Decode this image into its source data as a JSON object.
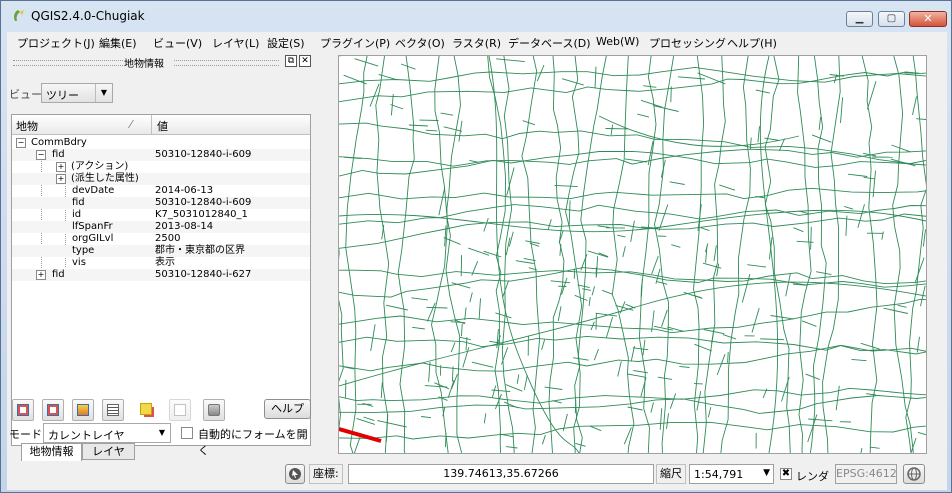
{
  "window": {
    "title": "QGIS2.4.0-Chugiak"
  },
  "menu": [
    "プロジェクト(J)",
    "編集(E)",
    "ビュー(V)",
    "レイヤ(L)",
    "設定(S)",
    "プラグイン(P)",
    "ベクタ(O)",
    "ラスタ(R)",
    "データベース(D)",
    "Web(W)",
    "プロセッシング",
    "ヘルプ(H)"
  ],
  "identify_panel": {
    "title": "地物情報",
    "view_label": "ビュー",
    "view_value": "ツリー",
    "columns": {
      "feature": "地物",
      "value": "値"
    },
    "layer": "CommBdry",
    "feature1": {
      "key": "fid",
      "value": "50310-12840-i-609"
    },
    "actions": "(アクション)",
    "derived": "(派生した属性)",
    "attributes": [
      {
        "key": "devDate",
        "value": "2014-06-13"
      },
      {
        "key": "fid",
        "value": "50310-12840-i-609"
      },
      {
        "key": "id",
        "value": "K7_5031012840_1"
      },
      {
        "key": "lfSpanFr",
        "value": "2013-08-14"
      },
      {
        "key": "orgGILvl",
        "value": "2500"
      },
      {
        "key": "type",
        "value": "郡市・東京都の区界"
      },
      {
        "key": "vis",
        "value": "表示"
      }
    ],
    "feature2": {
      "key": "fid",
      "value": "50310-12840-i-627"
    },
    "help_label": "ヘルプ",
    "mode_label": "モード",
    "mode_value": "カレントレイヤ",
    "auto_open_label": "自動的にフォームを開く",
    "tabs": [
      "地物情報",
      "レイヤ"
    ]
  },
  "statusbar": {
    "coord_label": "座標:",
    "coord_value": "139.74613,35.67266",
    "scale_label": "縮尺",
    "scale_value": "1:54,791",
    "render_label": "レンダ",
    "crs": "EPSG:4612"
  },
  "colors": {
    "roads": "#2e8b57",
    "highlight": "#e00000"
  }
}
